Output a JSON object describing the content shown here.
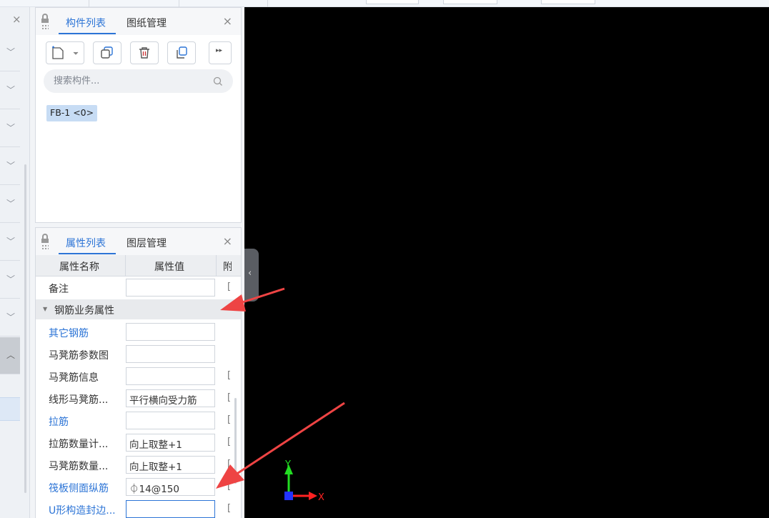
{
  "component_panel": {
    "tabs": [
      {
        "label": "构件列表",
        "active": true
      },
      {
        "label": "图纸管理",
        "active": false
      }
    ],
    "close_glyph": "×",
    "toolbar": {
      "new_icon": "new-file-icon",
      "dropdown_glyph": "▾",
      "copy_icon": "copy-icon",
      "delete_icon": "trash-icon",
      "layer_copy_icon": "layer-copy-icon",
      "more_glyph": "▸▸"
    },
    "search": {
      "placeholder": "搜索构件..."
    },
    "items": [
      {
        "label": "FB-1 <0>",
        "selected": true
      }
    ]
  },
  "property_panel": {
    "tabs": [
      {
        "label": "属性列表",
        "active": true
      },
      {
        "label": "图层管理",
        "active": false
      }
    ],
    "close_glyph": "×",
    "columns": [
      "属性名称",
      "属性值",
      "附"
    ],
    "rows": [
      {
        "name": "备注",
        "value": "",
        "ext": "["
      },
      {
        "group": "钢筋业务属性",
        "collapse_glyph": "▼"
      },
      {
        "name": "其它钢筋",
        "value": "",
        "link": true,
        "ext": ""
      },
      {
        "name": "马凳筋参数图",
        "value": "",
        "ext": ""
      },
      {
        "name": "马凳筋信息",
        "value": "",
        "ext": "["
      },
      {
        "name": "线形马凳筋...",
        "value": "平行横向受力筋",
        "ext": "["
      },
      {
        "name": "拉筋",
        "value": "",
        "link": true,
        "ext": "["
      },
      {
        "name": "拉筋数量计...",
        "value": "向上取整+1",
        "ext": "["
      },
      {
        "name": "马凳筋数量...",
        "value": "向上取整+1",
        "ext": "["
      },
      {
        "name": "筏板侧面纵筋",
        "value": "⏀14@150",
        "link": true,
        "ext": "["
      },
      {
        "name": "U形构造封边...",
        "value": "",
        "link": true,
        "ext": "[",
        "focused": true
      }
    ]
  },
  "left_panel": {
    "close_glyph": "×",
    "chevron_down": "﹀",
    "chevron_up": "︿"
  },
  "splitter": {
    "glyph": "‹"
  },
  "canvas": {
    "background": "#000000",
    "axis": {
      "y_label": "Y",
      "x_label": "X",
      "y_color": "#22dd22",
      "x_color": "#ff2222",
      "origin_color": "#2233ff"
    }
  },
  "annotations": {
    "arrow_color": "#ee4444"
  },
  "colors": {
    "accent": "#2c74d6",
    "selected_item": "#c7dcf4"
  }
}
